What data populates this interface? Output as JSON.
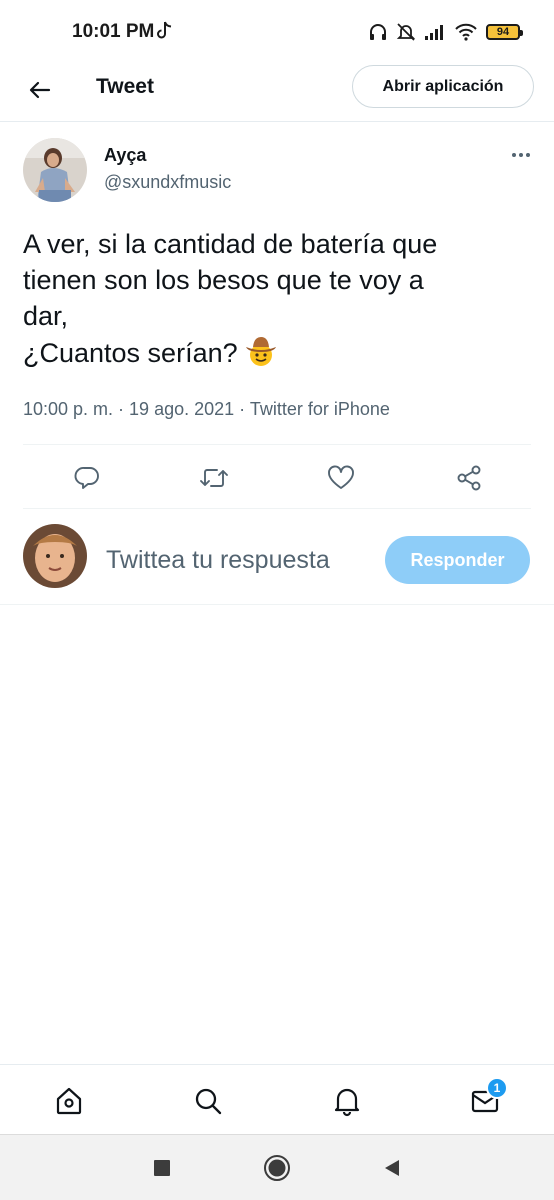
{
  "status_bar": {
    "time": "10:01 PM",
    "battery_level": "94",
    "icons": [
      "tiktok-icon",
      "headphones-icon",
      "bell-off-icon",
      "signal-icon",
      "wifi-icon",
      "battery-icon"
    ]
  },
  "header": {
    "title": "Tweet",
    "open_app_label": "Abrir aplicación"
  },
  "tweet": {
    "author_name": "Ayça",
    "author_handle": "@sxundxfmusic",
    "text_lines": [
      "A ver, si la cantidad de batería que",
      "tienen son los besos que te voy a",
      "dar,",
      "¿Cuantos serían?"
    ],
    "emoji": "cowboy-face-emoji",
    "meta": "10:00 p. m. · 19 ago. 2021 · Twitter for iPhone",
    "actions": [
      "reply-icon",
      "retweet-icon",
      "like-icon",
      "share-icon"
    ]
  },
  "reply": {
    "placeholder": "Twittea tu respuesta",
    "button_label": "Responder"
  },
  "tab_bar": {
    "tabs": [
      "home-icon",
      "search-icon",
      "notifications-icon",
      "messages-icon"
    ],
    "messages_badge": "1"
  },
  "android_nav": {
    "buttons": [
      "recents-icon",
      "home-circle-icon",
      "back-triangle-icon"
    ]
  },
  "colors": {
    "accent": "#1d9bf0",
    "reply_button": "#8ecdf8",
    "secondary_text": "#536471",
    "battery": "#f5c13a"
  }
}
